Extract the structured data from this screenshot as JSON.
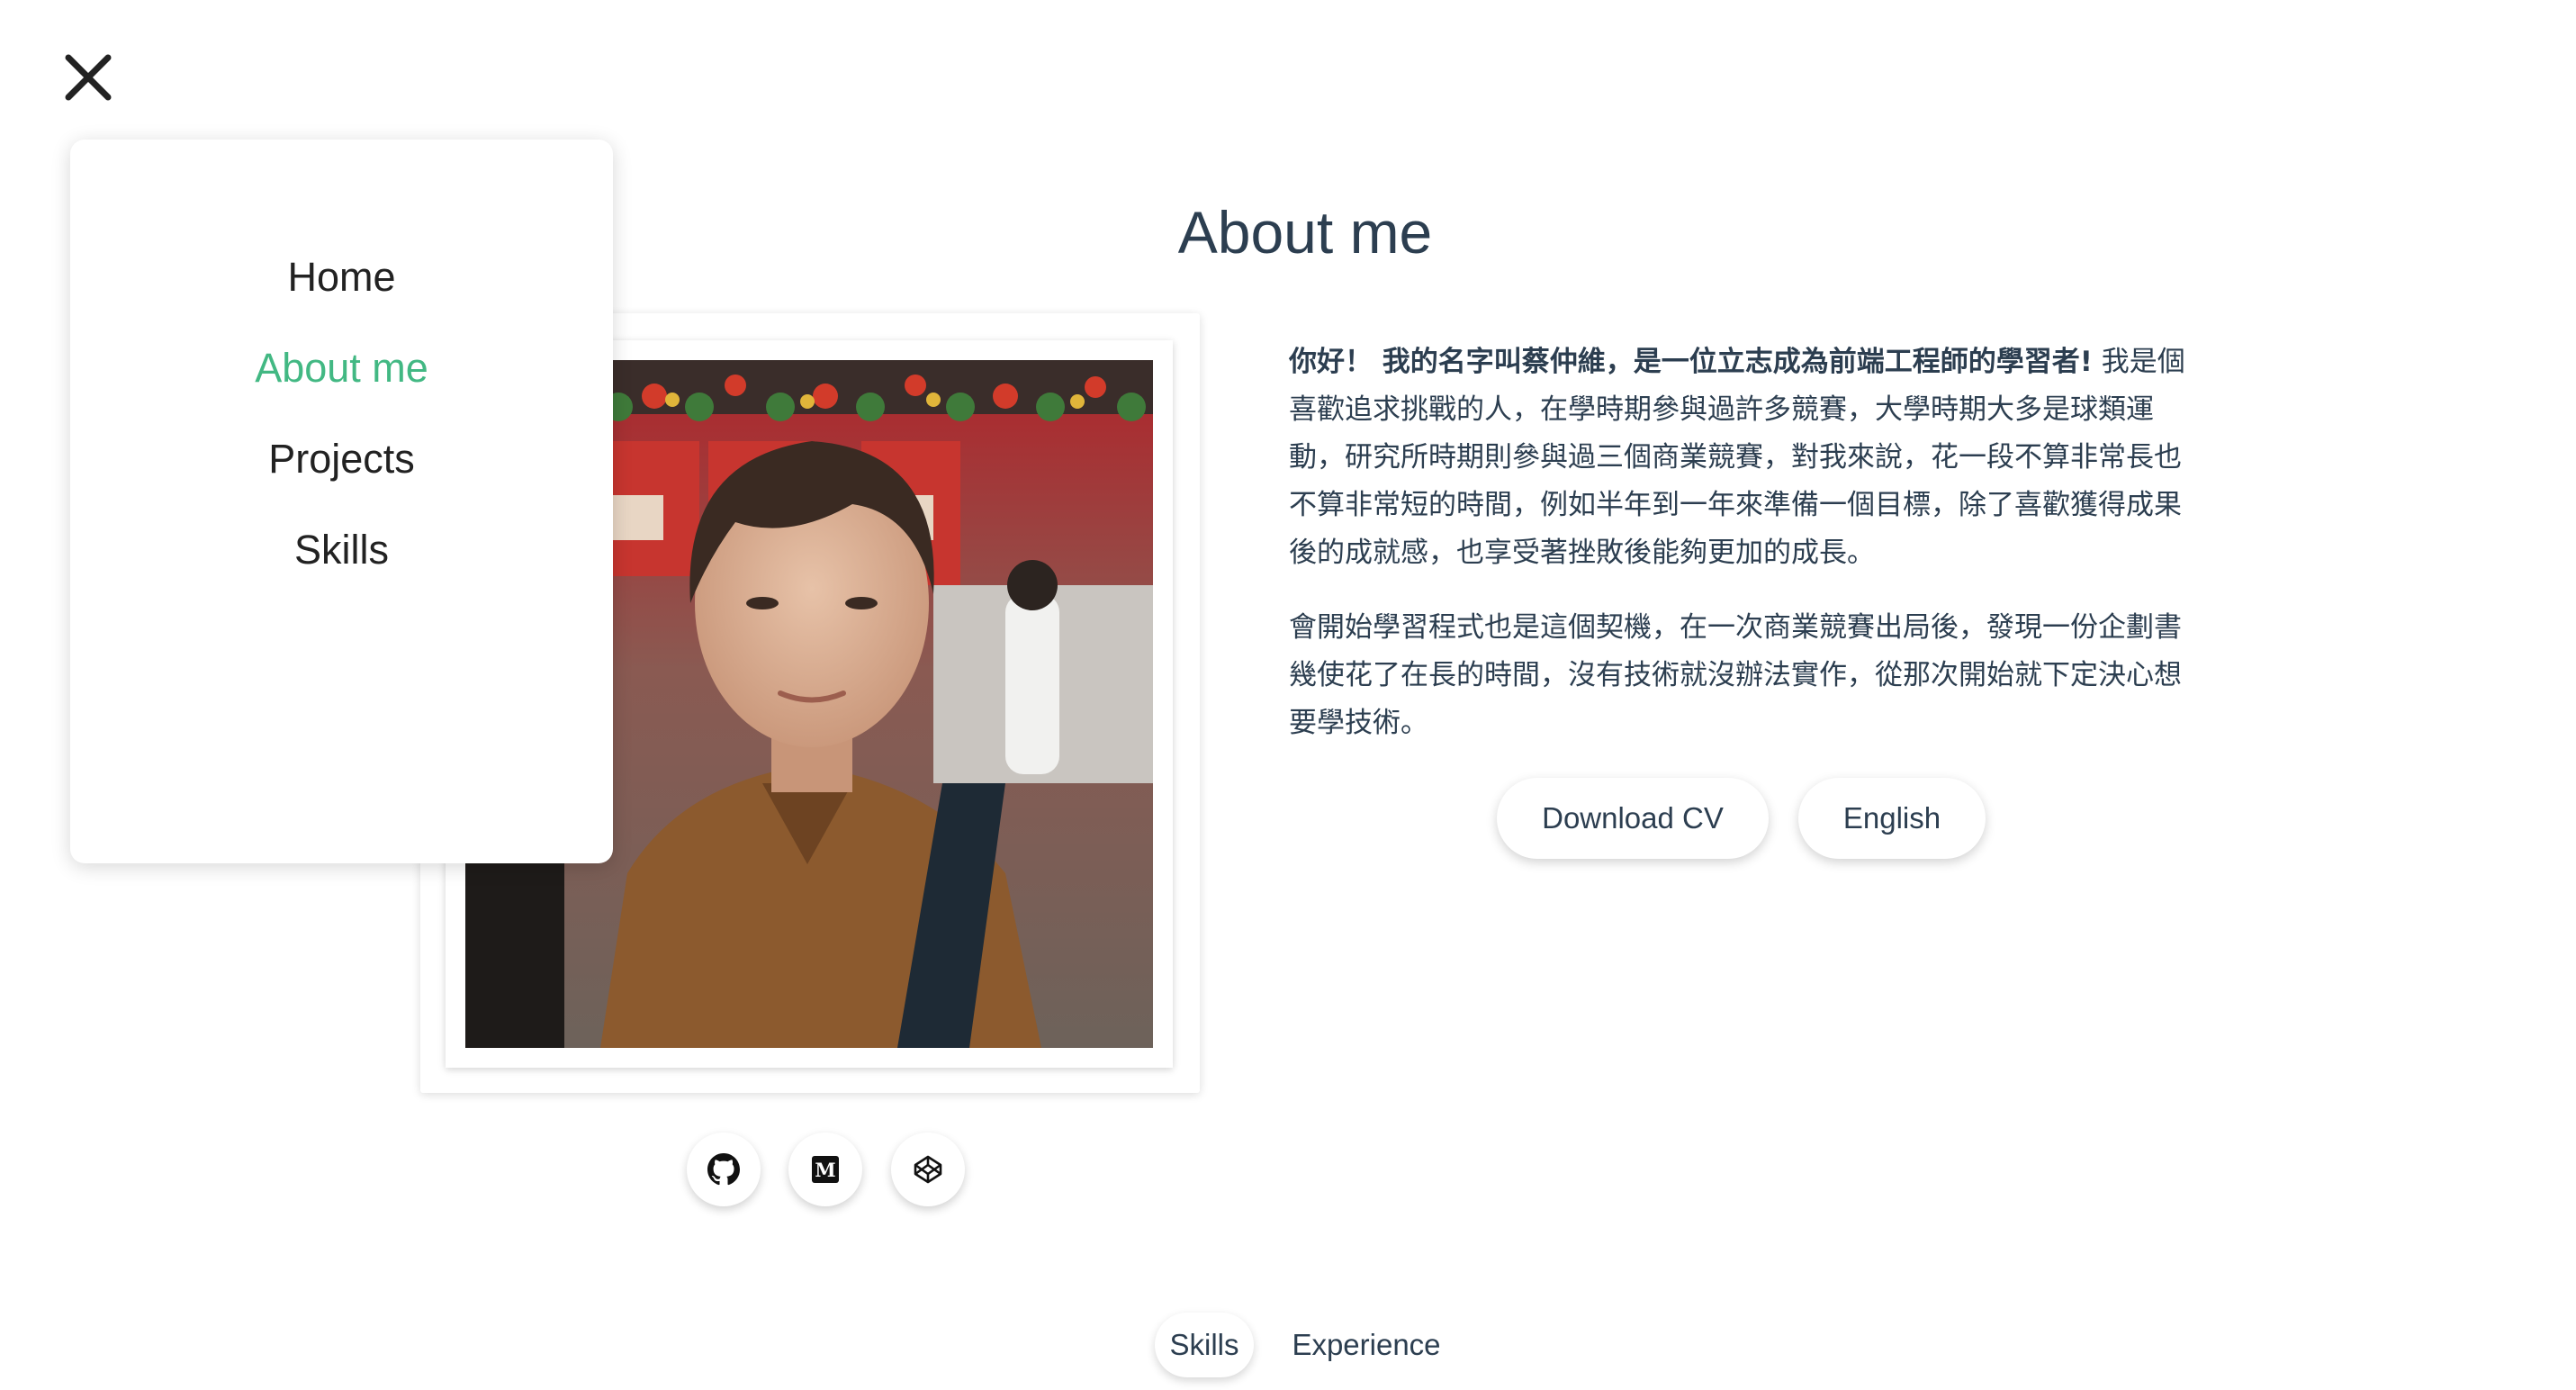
{
  "nav": {
    "close_icon": "close-icon",
    "menu_items": [
      {
        "label": "Home",
        "active": false
      },
      {
        "label": "About me",
        "active": true
      },
      {
        "label": "Projects",
        "active": false
      },
      {
        "label": "Skills",
        "active": false
      }
    ],
    "active_color": "#42b883"
  },
  "about": {
    "title": "About me",
    "photo": {
      "description": "portrait-photo"
    },
    "social": [
      {
        "name": "github",
        "icon": "github-icon"
      },
      {
        "name": "medium",
        "icon": "medium-icon"
      },
      {
        "name": "codepen",
        "icon": "codepen-icon"
      }
    ],
    "bio": {
      "intro_bold": "你好！ 我的名字叫蔡仲維，是一位立志成為前端工程師的學習者!",
      "intro_rest": " 我是個喜歡追求挑戰的人，在學時期參與過許多競賽，大學時期大多是球類運動，研究所時期則參與過三個商業競賽，對我來說，花一段不算非常長也不算非常短的時間，例如半年到一年來準備一個目標，除了喜歡獲得成果後的成就感，也享受著挫敗後能夠更加的成長。",
      "paragraph2": "會開始學習程式也是這個契機，在一次商業競賽出局後，發現一份企劃書幾使花了在長的時間，沒有技術就沒辦法實作，從那次開始就下定決心想要學技術。"
    },
    "buttons": {
      "download_cv": "Download CV",
      "language": "English"
    }
  },
  "tabs": [
    {
      "label": "Skills",
      "active": true
    },
    {
      "label": "Experience",
      "active": false
    }
  ],
  "colors": {
    "text": "#2c3e50",
    "accent": "#42b883",
    "background": "#ffffff"
  }
}
